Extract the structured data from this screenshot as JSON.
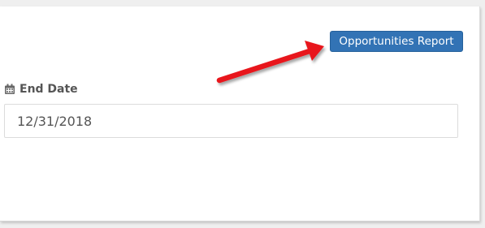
{
  "header": {
    "report_button_label": "Opportunities Report"
  },
  "form": {
    "end_date_label": "End Date",
    "end_date_value": "12/31/2018"
  },
  "icons": {
    "label_icon": "calendar-icon",
    "annotation": "red-arrow-icon"
  },
  "colors": {
    "button_bg": "#3273b5",
    "arrow": "#e8191b",
    "label_text": "#555555"
  }
}
